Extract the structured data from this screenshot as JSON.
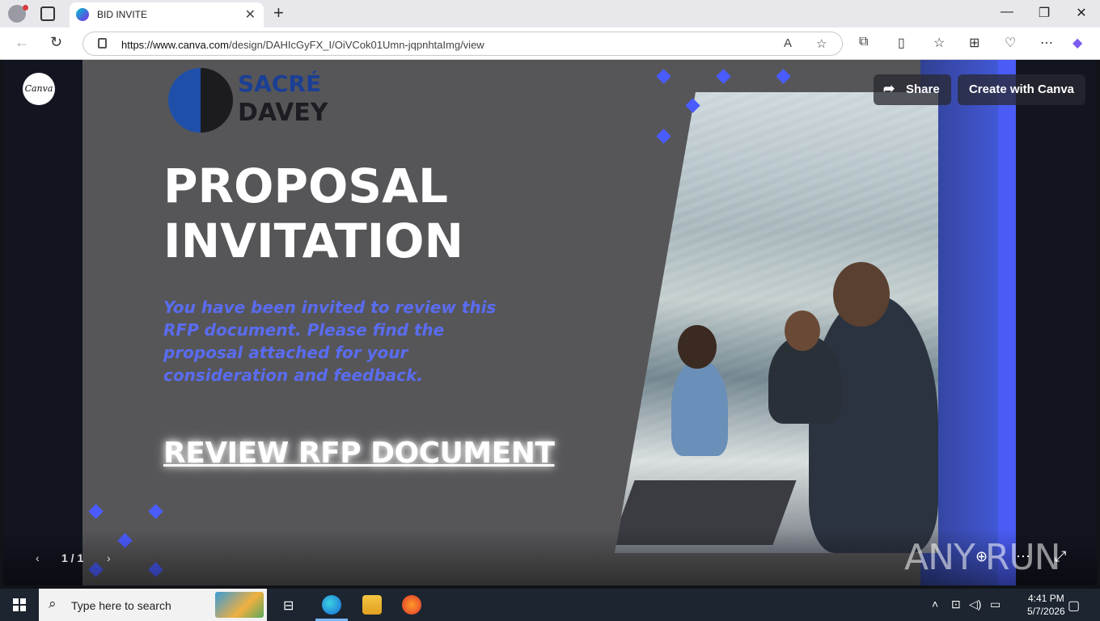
{
  "browser": {
    "tab_title": "BID INVITE",
    "url_host": "https://www.canva.com",
    "url_path": "/design/DAHIcGyFX_I/OiVCok01Umn-jqpnhtaImg/view",
    "icons": [
      "profile-icon",
      "tab-actions-icon",
      "close-icon",
      "new-tab-icon",
      "minimize-icon",
      "restore-icon",
      "window-close-icon",
      "back-icon",
      "refresh-icon",
      "lock-icon",
      "read-aloud-icon",
      "favorite-icon",
      "extensions-icon",
      "split-screen-icon",
      "favorites-icon",
      "collections-icon",
      "performance-icon",
      "more-icon",
      "copilot-icon"
    ]
  },
  "viewer": {
    "share_label": "Share",
    "create_label": "Create with Canva",
    "page_indicator": "1 / 1",
    "logo_text": "Canva"
  },
  "slide": {
    "brand_line1": "SACRÉ",
    "brand_line2": "DAVEY",
    "headline": "PROPOSAL INVITATION",
    "subtext": "You have been invited to review this RFP document. Please find the proposal attached for your consideration and feedback.",
    "cta": "REVIEW RFP DOCUMENT",
    "accent_color": "#4a5cff"
  },
  "watermark": "ANY RUN",
  "taskbar": {
    "search_placeholder": "Type here to search",
    "time": "4:41 PM",
    "date": "5/7/2026"
  }
}
